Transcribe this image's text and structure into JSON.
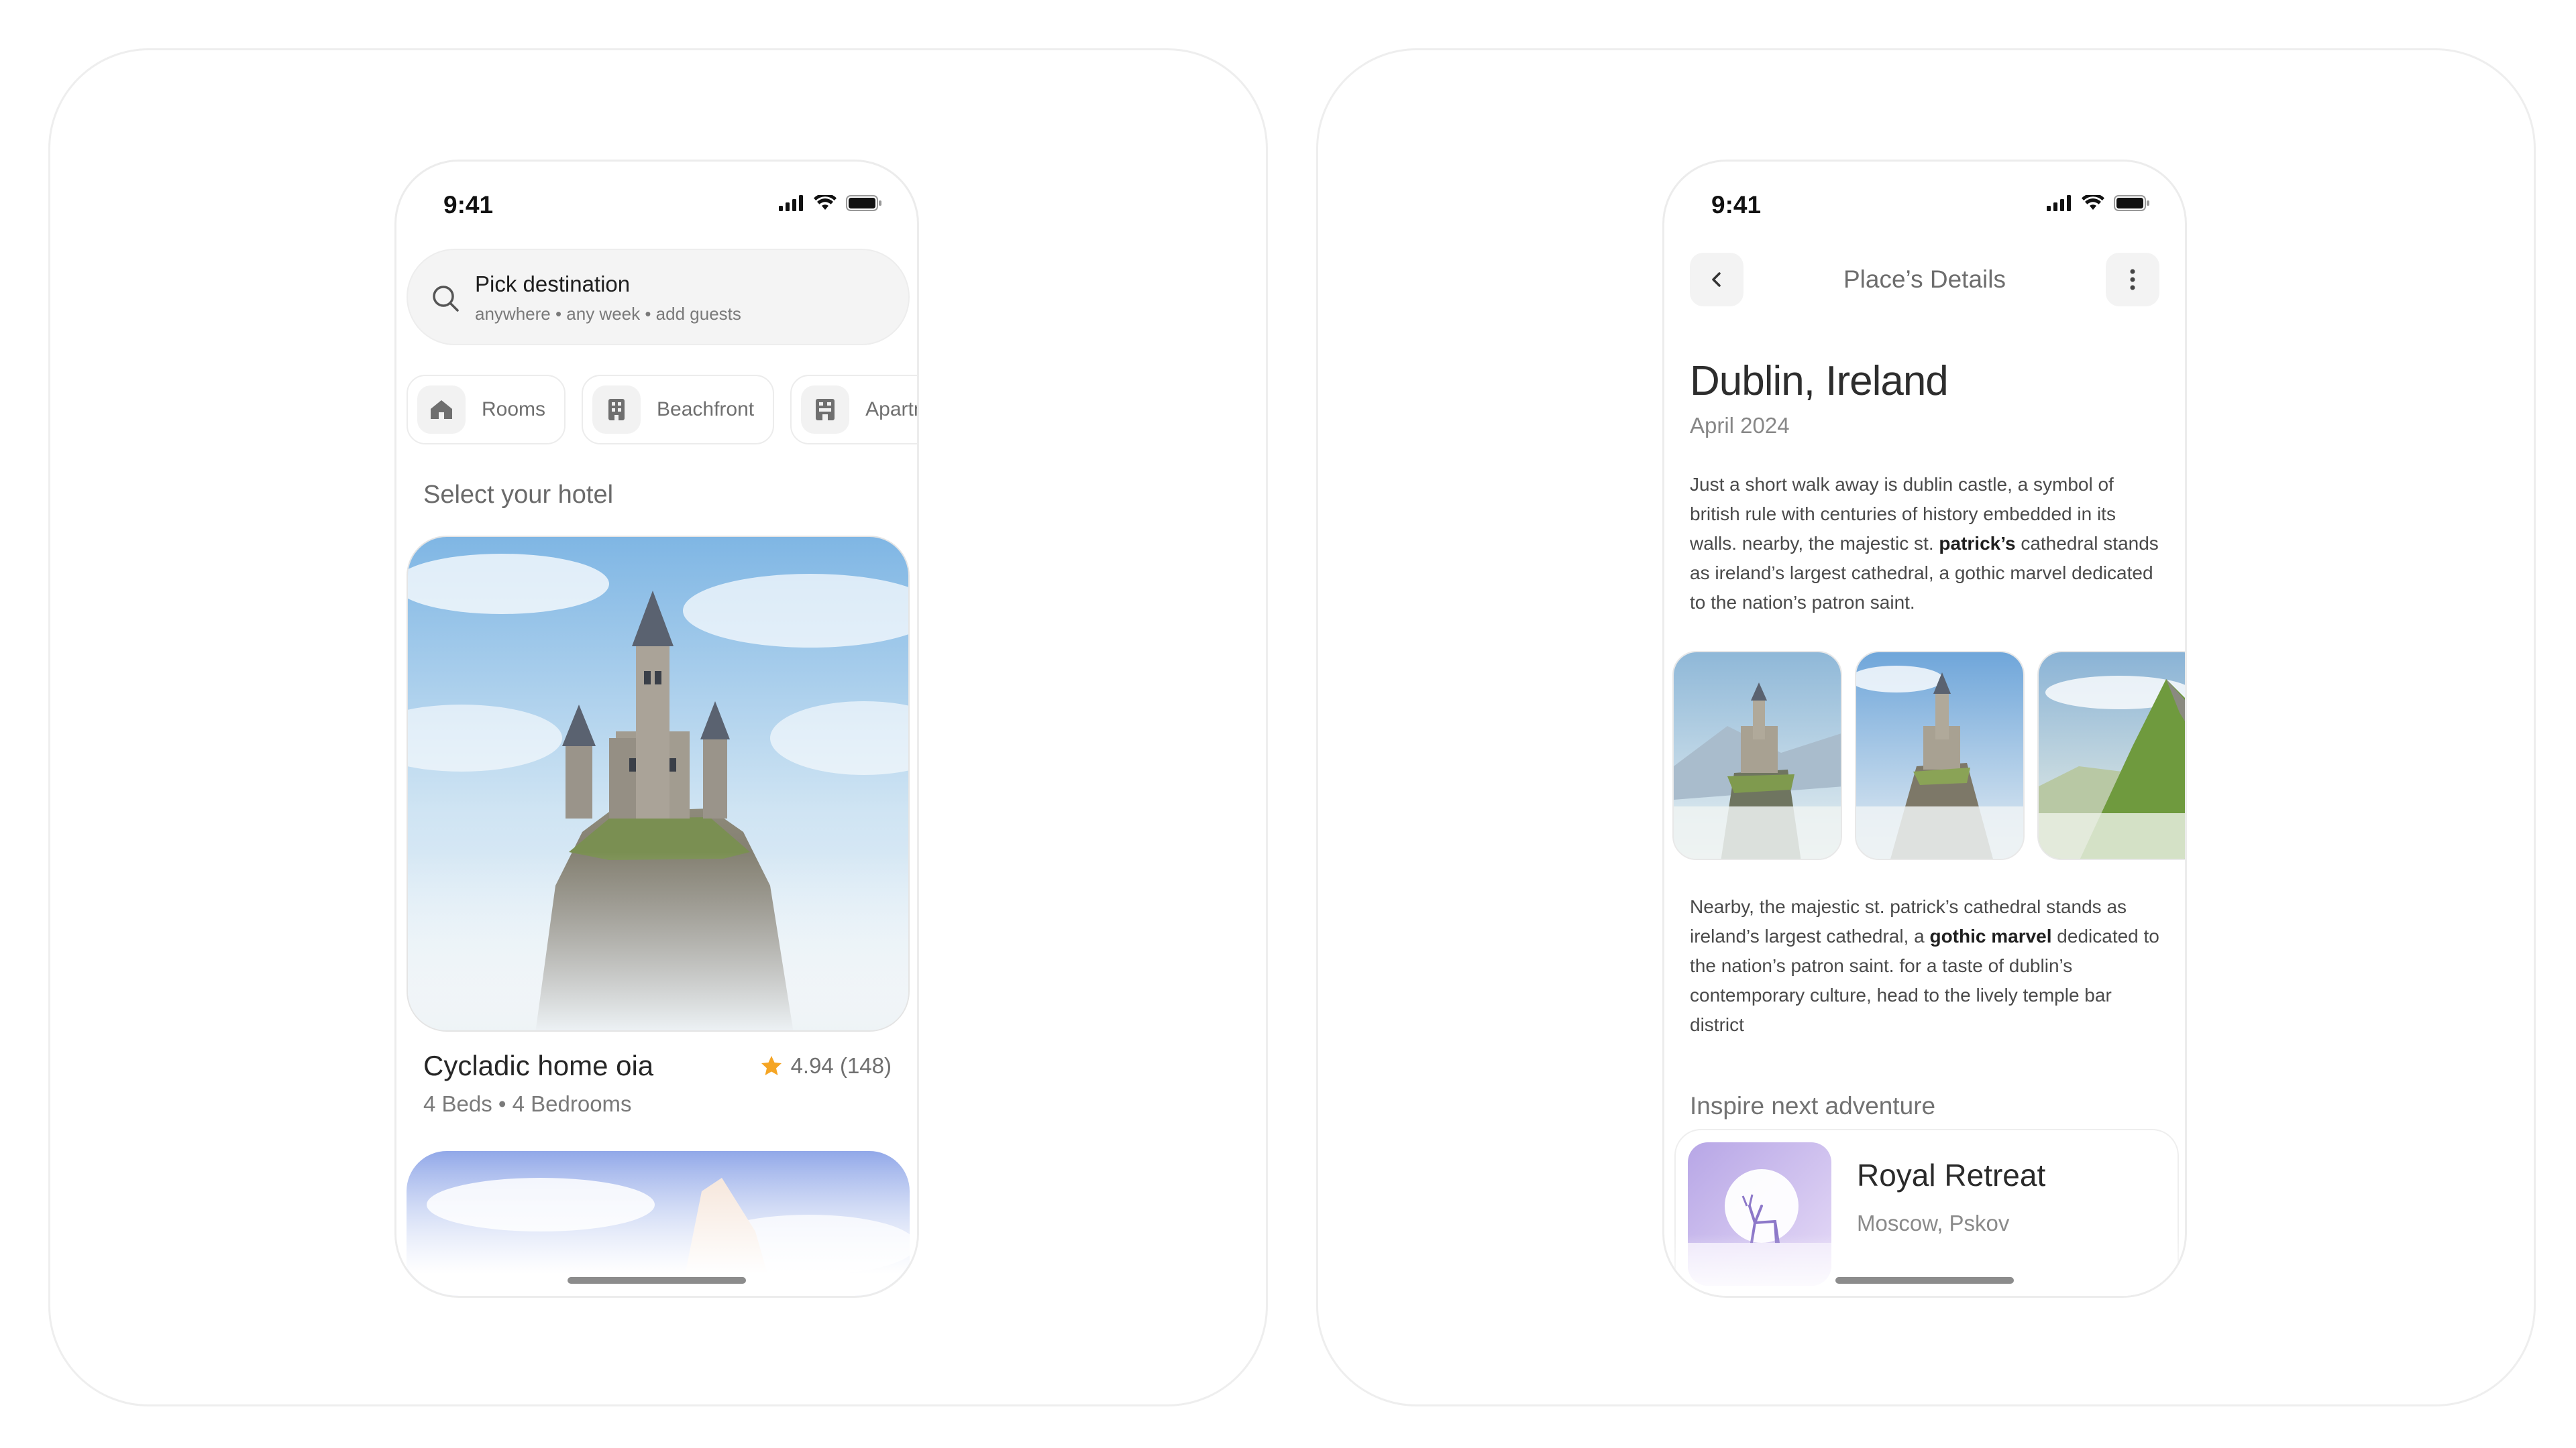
{
  "status_bar": {
    "time": "9:41"
  },
  "explore": {
    "search": {
      "title": "Pick destination",
      "subtitle": "anywhere • any week • add guests"
    },
    "categories": [
      {
        "label": "Rooms",
        "icon": "house-icon"
      },
      {
        "label": "Beachfront",
        "icon": "building-icon"
      },
      {
        "label": "Apartments",
        "icon": "apartment-icon"
      }
    ],
    "section_title": "Select your hotel",
    "listing": {
      "name": "Cycladic home oia",
      "rating": "4.94 (148)",
      "meta": "4 Beds • 4 Bedrooms"
    }
  },
  "details": {
    "nav_title": "Place’s Details",
    "title": "Dublin, Ireland",
    "date": "April 2024",
    "para1": {
      "before": "Just a short walk away is dublin castle, a symbol of british rule with centuries of history embedded in its walls. nearby, the majestic st. ",
      "bold": "patrick’s",
      "after": " cathedral stands as ireland’s largest cathedral, a gothic marvel dedicated to the nation’s patron saint."
    },
    "para2": {
      "before": "Nearby, the majestic st. patrick’s cathedral stands as ireland’s largest cathedral, a ",
      "bold": "gothic marvel",
      "after": " dedicated to the nation’s patron saint. for a taste of dublin’s contemporary culture, head to the lively temple bar district"
    },
    "inspire_title": "Inspire next adventure",
    "card": {
      "name": "Royal Retreat",
      "location": "Moscow, Pskov"
    }
  },
  "colors": {
    "star": "#f5a524",
    "accent_text": "#2a2a2a",
    "muted_text": "#7a7a7a"
  }
}
